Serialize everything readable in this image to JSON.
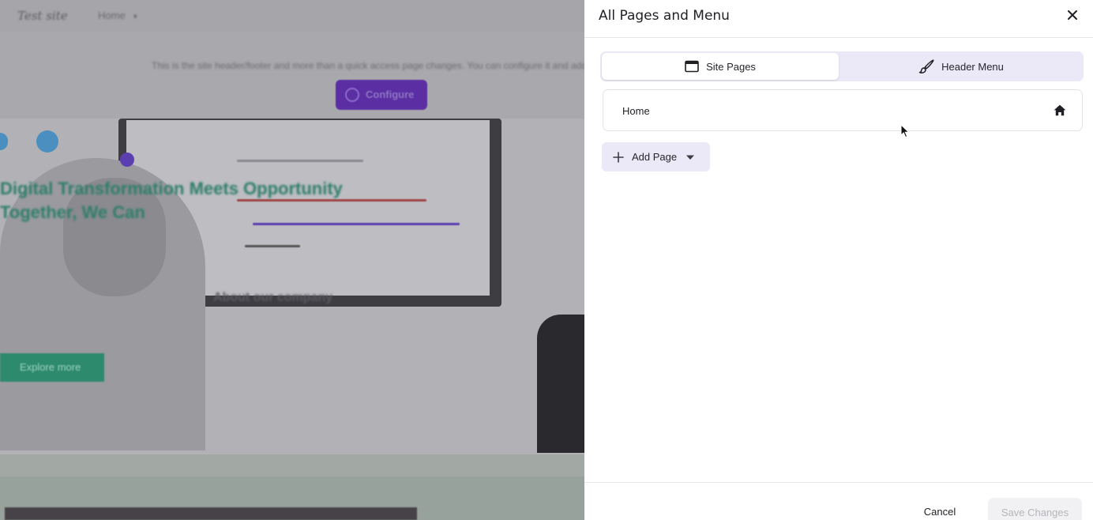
{
  "background": {
    "logo": "Test site",
    "nav_item": "Home",
    "notice": "This is the site header/footer and more than a quick access page changes. You can configure it and add more",
    "configure_label": "Configure",
    "hero_title_line1": "Digital Transformation Meets Opportunity",
    "hero_title_line2": "Together, We Can",
    "hero_caption": "About our company",
    "hero_button": "Explore more"
  },
  "panel": {
    "title": "All Pages and Menu",
    "tabs": [
      {
        "label": "Site Pages",
        "icon": "browser-window-icon",
        "active": true
      },
      {
        "label": "Header Menu",
        "icon": "brush-icon",
        "active": false
      }
    ],
    "pages": [
      {
        "label": "Home",
        "icon": "home-icon"
      }
    ],
    "add_page_label": "Add Page",
    "footer": {
      "cancel_label": "Cancel",
      "save_label": "Save Changes"
    }
  },
  "colors": {
    "accent_soft": "#ebe8f7",
    "overlay": "#9d9da1",
    "text_primary": "#1f1f24",
    "disabled_text": "#b5b5ba"
  }
}
